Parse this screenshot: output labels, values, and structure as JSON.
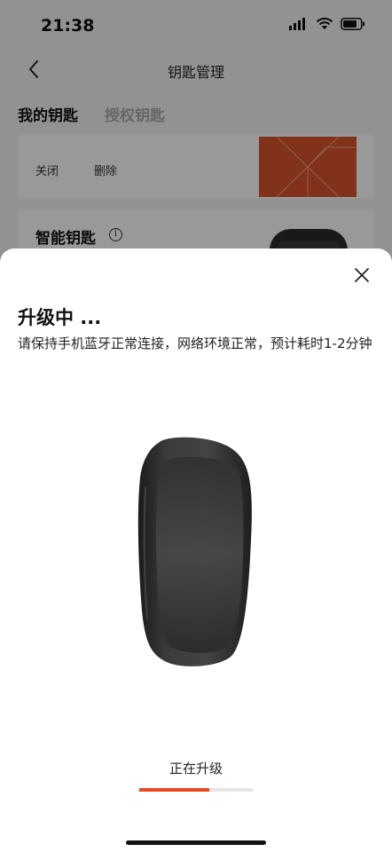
{
  "status_bar": {
    "time": "21:38"
  },
  "nav": {
    "title": "钥匙管理"
  },
  "tabs": [
    {
      "label": "我的钥匙",
      "active": true
    },
    {
      "label": "授权钥匙",
      "active": false
    }
  ],
  "key_card": {
    "close_label": "关闭",
    "delete_label": "删除"
  },
  "smart_key_card": {
    "title": "智能钥匙",
    "info_glyph": "i"
  },
  "sheet": {
    "title": "升级中 ...",
    "description": "请保持手机蓝牙正常连接，网络环境正常，预计耗时1-2分钟",
    "progress_label": "正在升级",
    "progress": 0.62
  },
  "colors": {
    "accent": "#ea4a21",
    "card_image": "#d9542c"
  }
}
